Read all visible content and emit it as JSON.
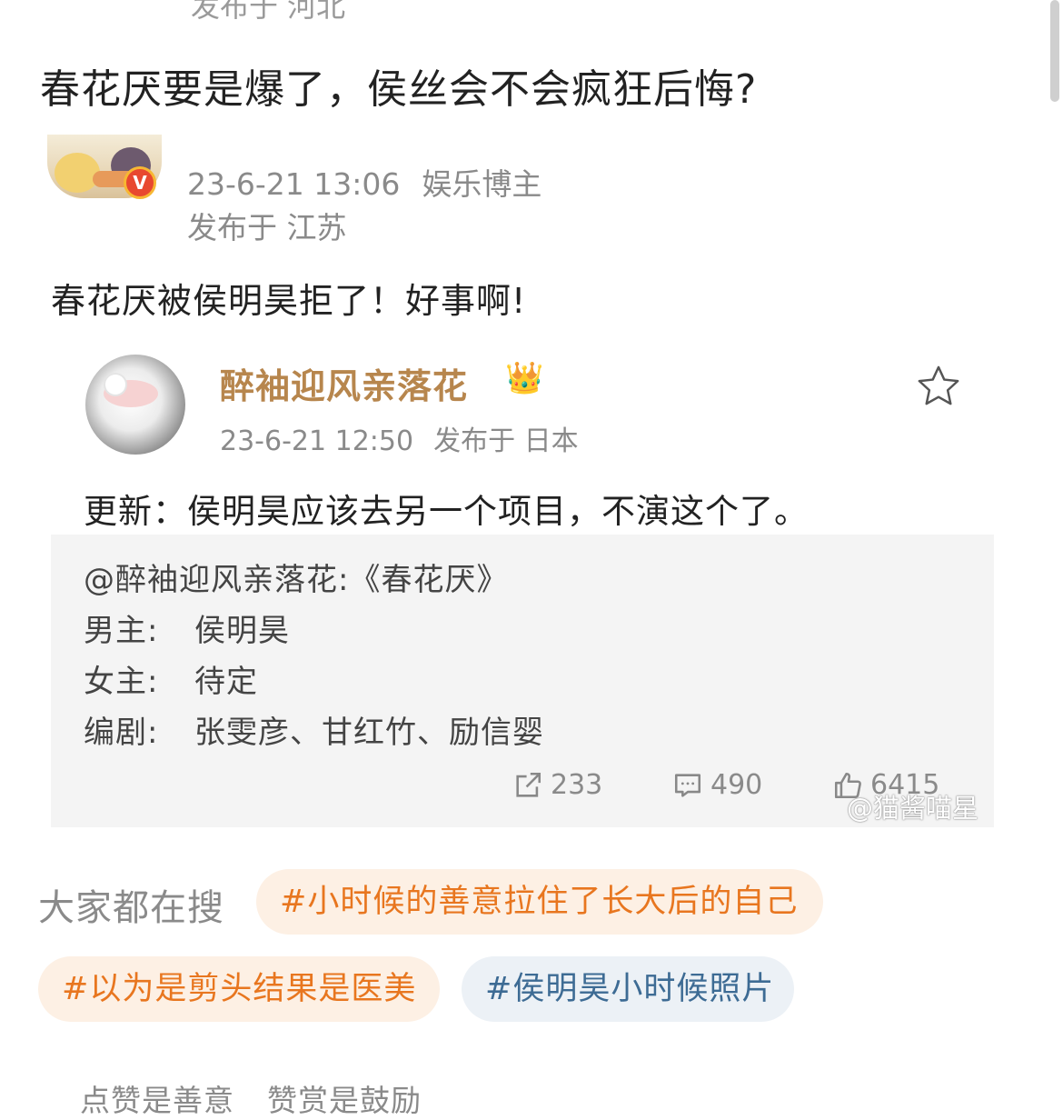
{
  "top_location": "发布于 河北",
  "post_title": "春花厌要是爆了，侯丝会不会疯狂后悔?",
  "comment": {
    "verified_badge": "V",
    "datetime": "23-6-21 13:06",
    "role": "娱乐博主",
    "location": "发布于 江苏",
    "text": "春花厌被侯明昊拒了！好事啊!"
  },
  "quoted_post": {
    "author": "醉袖迎风亲落花",
    "crown_icon": "👑",
    "datetime": "23-6-21 12:50",
    "location": "发布于 日本",
    "text": "更新：侯明昊应该去另一个项目，不演这个了。",
    "repost": {
      "title_line": "@醉袖迎风亲落花:《春花厌》",
      "lines": [
        {
          "label": "男主:",
          "value": "侯明昊"
        },
        {
          "label": "女主:",
          "value": "待定"
        },
        {
          "label": "编剧:",
          "value": "张雯彦、甘红竹、励信婴"
        }
      ],
      "shares": "233",
      "comments": "490",
      "likes": "6415"
    }
  },
  "watermark": "@猫酱喵星",
  "search_label": "大家都在搜",
  "tags": [
    {
      "text": "#小时候的善意拉住了长大后的自己",
      "color": "#e8761f"
    },
    {
      "text": "#以为是剪头结果是医美",
      "color": "#e8761f"
    },
    {
      "text": "#侯明昊小时候照片",
      "color": "#3d6b94"
    }
  ],
  "footer": {
    "left": "点赞是善意",
    "right": "赞赏是鼓励"
  }
}
